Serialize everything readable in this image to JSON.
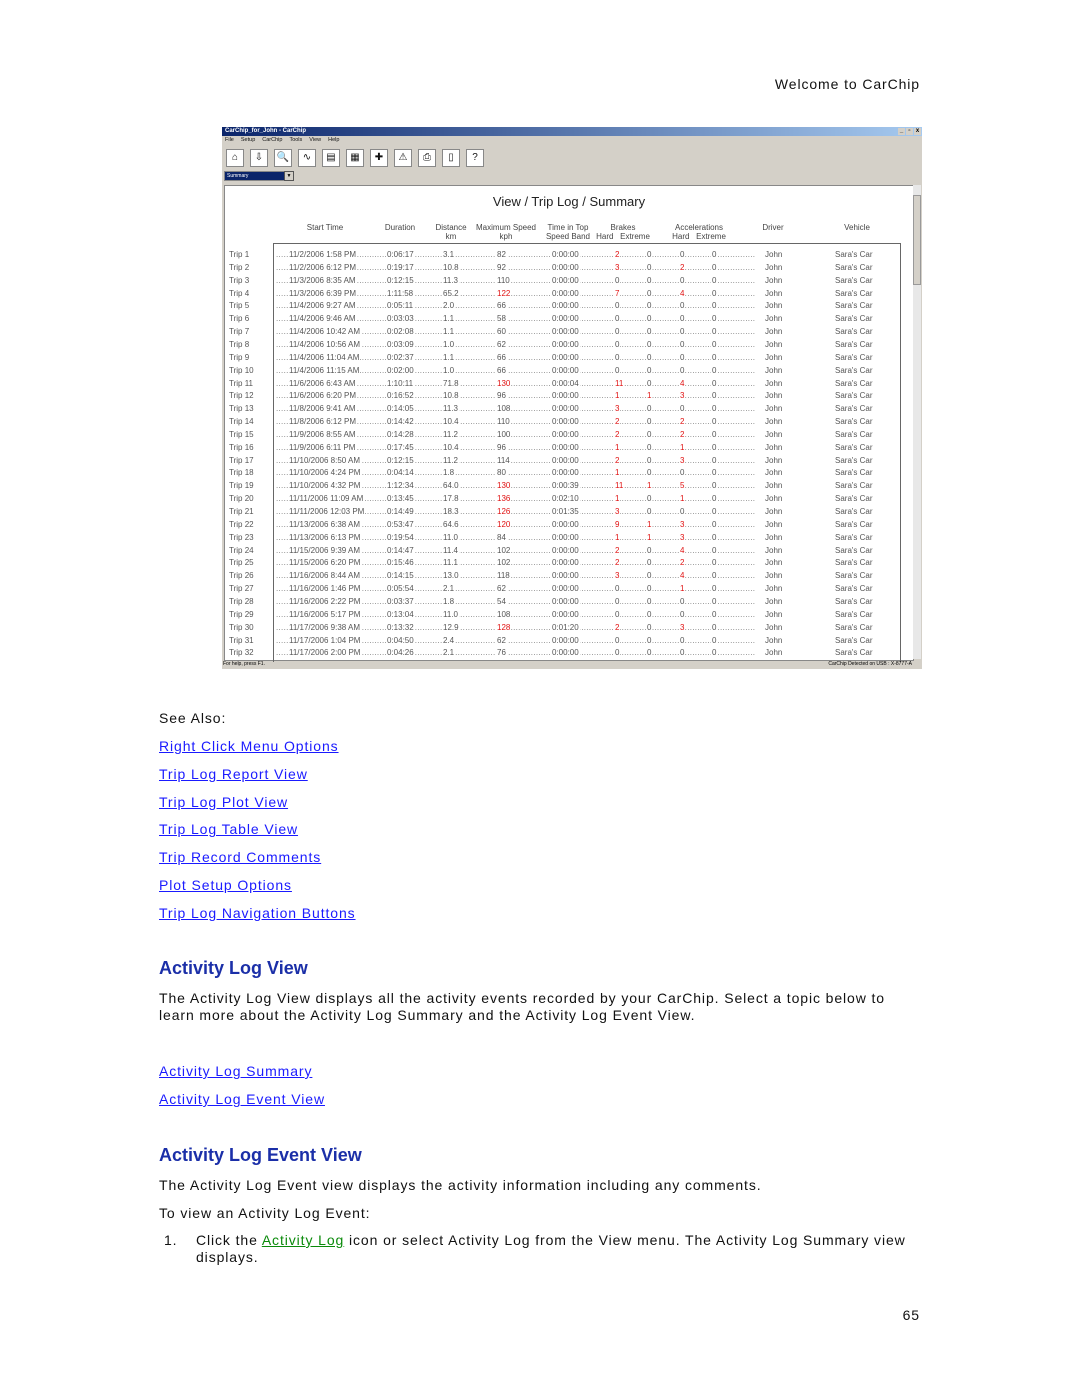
{
  "header": "Welcome to CarChip",
  "app": {
    "title": "CarChip_for_John - CarChip",
    "menu": [
      "File",
      "Setup",
      "CarChip",
      "Tools",
      "View",
      "Help"
    ],
    "toolbar_icons": [
      "home-icon",
      "download-icon",
      "search-icon",
      "plot-icon",
      "report-icon",
      "table-icon",
      "activity-log-icon",
      "alert-icon",
      "print-icon",
      "print-preview-icon",
      "help-icon"
    ],
    "view_select": "Summary",
    "view_title": "View / Trip Log / Summary",
    "columns": [
      "Start Time",
      "Duration",
      "Distance\nkm",
      "Maximum Speed\nkph",
      "Time in Top\nSpeed Band",
      "Brakes\nHard   Extreme",
      "Accelerations\nHard   Extreme",
      "Driver",
      "Vehicle"
    ],
    "rows": [
      [
        "Trip 1",
        "11/2/2006 1:58 PM",
        "0:06:17",
        "3.1",
        "82",
        "0:00:00",
        "2",
        "0",
        "0",
        "0",
        "John",
        "Sara's Car"
      ],
      [
        "Trip 2",
        "11/2/2006 6:12 PM",
        "0:19:17",
        "10.8",
        "92",
        "0:00:00",
        "3",
        "0",
        "2",
        "0",
        "John",
        "Sara's Car"
      ],
      [
        "Trip 3",
        "11/3/2006 8:35 AM",
        "0:12:15",
        "11.3",
        "110",
        "0:00:00",
        "0",
        "0",
        "0",
        "0",
        "John",
        "Sara's Car"
      ],
      [
        "Trip 4",
        "11/3/2006 6:39 PM",
        "1:11:58",
        "65.2",
        "122",
        "0:00:00",
        "7",
        "0",
        "4",
        "0",
        "John",
        "Sara's Car"
      ],
      [
        "Trip 5",
        "11/4/2006 9:27 AM",
        "0:05:11",
        "2.0",
        "66",
        "0:00:00",
        "0",
        "0",
        "0",
        "0",
        "John",
        "Sara's Car"
      ],
      [
        "Trip 6",
        "11/4/2006 9:46 AM",
        "0:03:03",
        "1.1",
        "58",
        "0:00:00",
        "0",
        "0",
        "0",
        "0",
        "John",
        "Sara's Car"
      ],
      [
        "Trip 7",
        "11/4/2006 10:42 AM",
        "0:02:08",
        "1.1",
        "60",
        "0:00:00",
        "0",
        "0",
        "0",
        "0",
        "John",
        "Sara's Car"
      ],
      [
        "Trip 8",
        "11/4/2006 10:56 AM",
        "0:03:09",
        "1.0",
        "62",
        "0:00:00",
        "0",
        "0",
        "0",
        "0",
        "John",
        "Sara's Car"
      ],
      [
        "Trip 9",
        "11/4/2006 11:04 AM",
        "0:02:37",
        "1.1",
        "66",
        "0:00:00",
        "0",
        "0",
        "0",
        "0",
        "John",
        "Sara's Car"
      ],
      [
        "Trip 10",
        "11/4/2006 11:15 AM",
        "0:02:00",
        "1.0",
        "66",
        "0:00:00",
        "0",
        "0",
        "0",
        "0",
        "John",
        "Sara's Car"
      ],
      [
        "Trip 11",
        "11/6/2006 6:43 AM",
        "1:10:11",
        "71.8",
        "130",
        "0:00:04",
        "11",
        "0",
        "4",
        "0",
        "John",
        "Sara's Car"
      ],
      [
        "Trip 12",
        "11/6/2006 6:20 PM",
        "0:16:52",
        "10.8",
        "96",
        "0:00:00",
        "1",
        "1",
        "3",
        "0",
        "John",
        "Sara's Car"
      ],
      [
        "Trip 13",
        "11/8/2006 9:41 AM",
        "0:14:05",
        "11.3",
        "108",
        "0:00:00",
        "3",
        "0",
        "0",
        "0",
        "John",
        "Sara's Car"
      ],
      [
        "Trip 14",
        "11/8/2006 6:12 PM",
        "0:14:42",
        "10.4",
        "110",
        "0:00:00",
        "2",
        "0",
        "2",
        "0",
        "John",
        "Sara's Car"
      ],
      [
        "Trip 15",
        "11/9/2006 8:55 AM",
        "0:14:28",
        "11.2",
        "100",
        "0:00:00",
        "2",
        "0",
        "2",
        "0",
        "John",
        "Sara's Car"
      ],
      [
        "Trip 16",
        "11/9/2006 6:11 PM",
        "0:17:45",
        "10.4",
        "96",
        "0:00:00",
        "1",
        "0",
        "1",
        "0",
        "John",
        "Sara's Car"
      ],
      [
        "Trip 17",
        "11/10/2006 8:50 AM",
        "0:12:15",
        "11.2",
        "114",
        "0:00:00",
        "2",
        "0",
        "3",
        "0",
        "John",
        "Sara's Car"
      ],
      [
        "Trip 18",
        "11/10/2006 4:24 PM",
        "0:04:14",
        "1.8",
        "80",
        "0:00:00",
        "1",
        "0",
        "0",
        "0",
        "John",
        "Sara's Car"
      ],
      [
        "Trip 19",
        "11/10/2006 4:32 PM",
        "1:12:34",
        "64.0",
        "130",
        "0:00:39",
        "11",
        "1",
        "5",
        "0",
        "John",
        "Sara's Car"
      ],
      [
        "Trip 20",
        "11/11/2006 11:09 AM",
        "0:13:45",
        "17.8",
        "136",
        "0:02:10",
        "1",
        "0",
        "1",
        "0",
        "John",
        "Sara's Car"
      ],
      [
        "Trip 21",
        "11/11/2006 12:03 PM",
        "0:14:49",
        "18.3",
        "126",
        "0:01:35",
        "3",
        "0",
        "0",
        "0",
        "John",
        "Sara's Car"
      ],
      [
        "Trip 22",
        "11/13/2006 6:38 AM",
        "0:53:47",
        "64.6",
        "120",
        "0:00:00",
        "9",
        "1",
        "3",
        "0",
        "John",
        "Sara's Car"
      ],
      [
        "Trip 23",
        "11/13/2006 6:13 PM",
        "0:19:54",
        "11.0",
        "84",
        "0:00:00",
        "1",
        "1",
        "3",
        "0",
        "John",
        "Sara's Car"
      ],
      [
        "Trip 24",
        "11/15/2006 9:39 AM",
        "0:14:47",
        "11.4",
        "102",
        "0:00:00",
        "2",
        "0",
        "4",
        "0",
        "John",
        "Sara's Car"
      ],
      [
        "Trip 25",
        "11/15/2006 6:20 PM",
        "0:15:46",
        "11.1",
        "102",
        "0:00:00",
        "2",
        "0",
        "2",
        "0",
        "John",
        "Sara's Car"
      ],
      [
        "Trip 26",
        "11/16/2006 8:44 AM",
        "0:14:15",
        "13.0",
        "118",
        "0:00:00",
        "3",
        "0",
        "4",
        "0",
        "John",
        "Sara's Car"
      ],
      [
        "Trip 27",
        "11/16/2006 1:46 PM",
        "0:05:54",
        "2.1",
        "62",
        "0:00:00",
        "0",
        "0",
        "1",
        "0",
        "John",
        "Sara's Car"
      ],
      [
        "Trip 28",
        "11/16/2006 2:22 PM",
        "0:03:37",
        "1.8",
        "54",
        "0:00:00",
        "0",
        "0",
        "0",
        "0",
        "John",
        "Sara's Car"
      ],
      [
        "Trip 29",
        "11/16/2006 5:17 PM",
        "0:13:04",
        "11.0",
        "108",
        "0:00:00",
        "0",
        "0",
        "0",
        "0",
        "John",
        "Sara's Car"
      ],
      [
        "Trip 30",
        "11/17/2006 9:38 AM",
        "0:13:32",
        "12.9",
        "128",
        "0:01:20",
        "2",
        "0",
        "3",
        "0",
        "John",
        "Sara's Car"
      ],
      [
        "Trip 31",
        "11/17/2006 1:04 PM",
        "0:04:50",
        "2.4",
        "62",
        "0:00:00",
        "0",
        "0",
        "0",
        "0",
        "John",
        "Sara's Car"
      ],
      [
        "Trip 32",
        "11/17/2006 2:00 PM",
        "0:04:26",
        "2.1",
        "76",
        "0:00:00",
        "0",
        "0",
        "0",
        "0",
        "John",
        "Sara's Car"
      ]
    ],
    "status_left": "For help, press F1.",
    "status_right": "CarChip Detected on USB : X-8777-A",
    "highlight_color": "#e01010"
  },
  "see_also": {
    "label": "See Also:",
    "links": [
      "Right Click Menu Options",
      "Trip Log Report View",
      "Trip Log Plot View",
      "Trip Log Table View",
      "Trip Record Comments",
      "Plot Setup Options",
      "Trip Log Navigation Buttons"
    ]
  },
  "activity_log_view": {
    "title": "Activity Log View",
    "text": "The Activity Log View displays all the activity events recorded by your CarChip. Select a topic below to learn more about the Activity Log Summary and the Activity Log Event View.",
    "links": [
      "Activity Log Summary",
      "Activity Log Event View"
    ]
  },
  "activity_log_event_view": {
    "title": "Activity Log Event View",
    "text": "The Activity Log Event view displays the activity information including any comments.",
    "intro": "To view an Activity Log Event:",
    "step_num": "1.",
    "step_pre": "Click the ",
    "step_link": "Activity Log",
    "step_post": " icon or select Activity Log from the View  menu. The Activity Log Summary view displays."
  },
  "page_number": "65"
}
